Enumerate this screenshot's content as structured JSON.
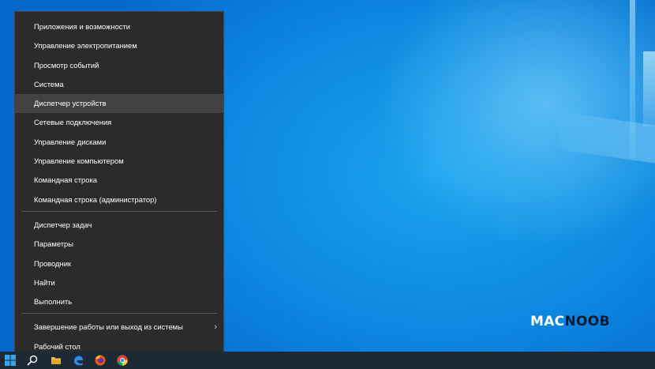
{
  "context_menu": {
    "group1": [
      {
        "label": "Приложения и возможности"
      },
      {
        "label": "Управление электропитанием"
      },
      {
        "label": "Просмотр событий"
      },
      {
        "label": "Система"
      },
      {
        "label": "Диспетчер устройств"
      },
      {
        "label": "Сетевые подключения"
      },
      {
        "label": "Управление дисками"
      },
      {
        "label": "Управление компьютером"
      },
      {
        "label": "Командная строка"
      },
      {
        "label": "Командная строка (администратор)"
      }
    ],
    "group2": [
      {
        "label": "Диспетчер задач"
      },
      {
        "label": "Параметры"
      },
      {
        "label": "Проводник"
      },
      {
        "label": "Найти"
      },
      {
        "label": "Выполнить"
      }
    ],
    "group3": [
      {
        "label": "Завершение работы или выход из системы",
        "has_submenu": true,
        "submenu_icon": "chevron-right-icon"
      },
      {
        "label": "Рабочий стол"
      }
    ],
    "highlighted_item": "Диспетчер устройств"
  },
  "watermark": {
    "part1": "MAC",
    "part2": "NOOB"
  },
  "taskbar": {
    "icons": [
      "windows-start-icon",
      "search-icon",
      "file-explorer-icon",
      "edge-icon",
      "firefox-icon",
      "chrome-icon"
    ]
  },
  "colors": {
    "menu_bg": "#2b2b2b",
    "menu_highlight": "#414141",
    "menu_text": "#ffffff",
    "desktop_accent": "#0d87df",
    "taskbar_bg": "#1d2a36"
  }
}
